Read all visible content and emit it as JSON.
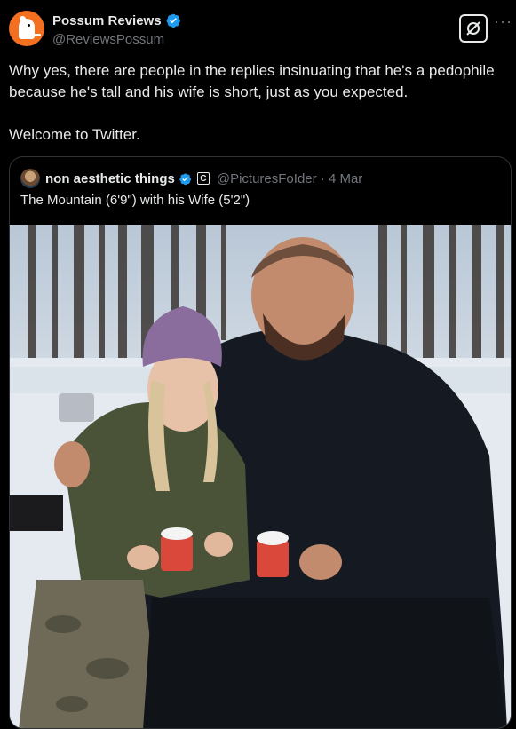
{
  "author": {
    "display_name": "Possum Reviews",
    "handle": "@ReviewsPossum",
    "verified": true,
    "avatar_icon": "possum-avatar-icon"
  },
  "actions": {
    "grok_icon": "grok-icon",
    "more_icon": "more-icon",
    "more_label": "···"
  },
  "tweet": {
    "line1": "Why yes, there are people in the replies insinuating that he's a pedophile because he's tall and his wife is short, just as you expected.",
    "line2": "Welcome to Twitter."
  },
  "quote": {
    "display_name": "non aesthetic things",
    "badge": "C",
    "handle_time": "@PicturesFoIder · 4 Mar",
    "text": "The Mountain (6'9\") with his Wife (5'2\")",
    "image_desc_icon": "photo"
  },
  "colors": {
    "background": "#000000",
    "text": "#e7e9ea",
    "muted": "#71767b",
    "verified": "#1d9bf0",
    "avatar_bg": "#f37021",
    "border": "#2f3336"
  }
}
